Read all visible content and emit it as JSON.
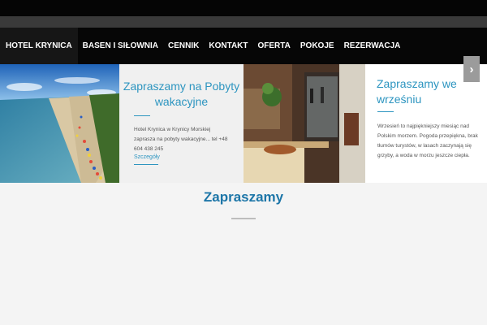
{
  "nav": {
    "items": [
      "HOTEL KRYNICA",
      "BASEN I SIŁOWNIA",
      "CENNIK",
      "KONTAKT",
      "OFERTA",
      "POKOJE",
      "REZERWACJA"
    ]
  },
  "slides": {
    "card1": {
      "title": "Zapraszamy na Pobyty wakacyjne",
      "text": "Hotel Krynica w Krynicy Morskiej zaprasza na pobyty wakacyjne... tel +48 604 438 245",
      "link": "Szczegóły"
    },
    "card2": {
      "title": "Zapraszamy we wrześniu",
      "text": "Wrzesień to najpiękniejszy miesiąc nad Polskim morzem. Pogoda przepiękna, brak tłumów turystów, w lasach zaczynają się grzyby, a woda w morzu jeszcze ciepła."
    },
    "next_icon": "chevron-right-icon"
  },
  "main": {
    "heading": "Zapraszamy"
  },
  "colors": {
    "accent": "#2d95c0",
    "heading": "#1d76a8",
    "nav_bg": "#060606"
  }
}
